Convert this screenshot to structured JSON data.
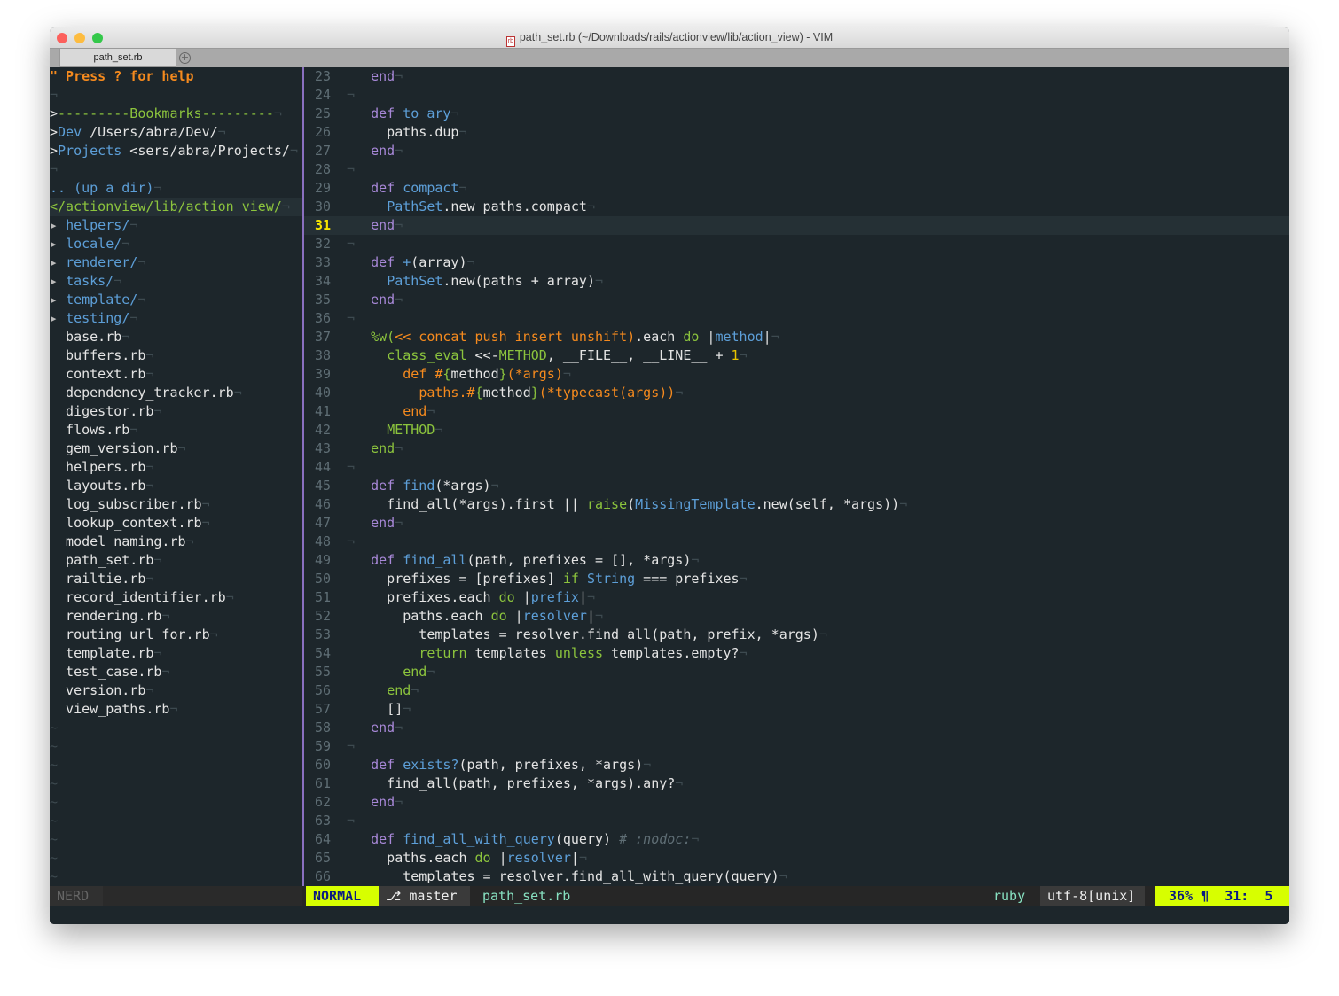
{
  "window": {
    "title": "path_set.rb (~/Downloads/rails/actionview/lib/action_view) - VIM",
    "file_icon": "ruby-file-icon",
    "tab": "path_set.rb",
    "new_tab": "+"
  },
  "colors": {
    "background": "#1d262b",
    "keyword": "#a888d8",
    "function": "#5d9fd8",
    "green": "#8cc43d",
    "orange": "#f58a1e",
    "mode_bg": "#d7ff00",
    "divider": "#8a6fbf"
  },
  "tree": {
    "rows": [
      [
        [
          "\" Press ? for help",
          "help"
        ]
      ],
      [],
      [
        [
          ">",
          "t"
        ],
        [
          "---------Bookmarks---------",
          "tl"
        ]
      ],
      [
        [
          ">",
          "t"
        ],
        [
          "Dev",
          "bmname"
        ],
        [
          " /Users/abra/Dev/",
          "t"
        ]
      ],
      [
        [
          ">",
          "t"
        ],
        [
          "Projects",
          "bmname"
        ],
        [
          " <sers/abra/Projects/",
          "t"
        ]
      ],
      [],
      [
        [
          ".. (up a dir)",
          "up"
        ]
      ],
      [
        [
          "</actionview/lib/action_view/",
          "cwd"
        ]
      ],
      [
        [
          "▸ ",
          "arrow"
        ],
        [
          "helpers/",
          "dir"
        ]
      ],
      [
        [
          "▸ ",
          "arrow"
        ],
        [
          "locale/",
          "dir"
        ]
      ],
      [
        [
          "▸ ",
          "arrow"
        ],
        [
          "renderer/",
          "dir"
        ]
      ],
      [
        [
          "▸ ",
          "arrow"
        ],
        [
          "tasks/",
          "dir"
        ]
      ],
      [
        [
          "▸ ",
          "arrow"
        ],
        [
          "template/",
          "dir"
        ]
      ],
      [
        [
          "▸ ",
          "arrow"
        ],
        [
          "testing/",
          "dir"
        ]
      ],
      [
        [
          "  base.rb",
          "t"
        ]
      ],
      [
        [
          "  buffers.rb",
          "t"
        ]
      ],
      [
        [
          "  context.rb",
          "t"
        ]
      ],
      [
        [
          "  dependency_tracker.rb",
          "t"
        ]
      ],
      [
        [
          "  digestor.rb",
          "t"
        ]
      ],
      [
        [
          "  flows.rb",
          "t"
        ]
      ],
      [
        [
          "  gem_version.rb",
          "t"
        ]
      ],
      [
        [
          "  helpers.rb",
          "t"
        ]
      ],
      [
        [
          "  layouts.rb",
          "t"
        ]
      ],
      [
        [
          "  log_subscriber.rb",
          "t"
        ]
      ],
      [
        [
          "  lookup_context.rb",
          "t"
        ]
      ],
      [
        [
          "  model_naming.rb",
          "t"
        ]
      ],
      [
        [
          "  path_set.rb",
          "t"
        ]
      ],
      [
        [
          "  railtie.rb",
          "t"
        ]
      ],
      [
        [
          "  record_identifier.rb",
          "t"
        ]
      ],
      [
        [
          "  rendering.rb",
          "t"
        ]
      ],
      [
        [
          "  routing_url_for.rb",
          "t"
        ]
      ],
      [
        [
          "  template.rb",
          "t"
        ]
      ],
      [
        [
          "  test_case.rb",
          "t"
        ]
      ],
      [
        [
          "  version.rb",
          "t"
        ]
      ],
      [
        [
          "  view_paths.rb",
          "t"
        ]
      ]
    ],
    "tilde": "~"
  },
  "editor": {
    "eol_marker": "¬",
    "cursor_line": 31,
    "lines": [
      {
        "n": "23",
        "t": [
          [
            "    ",
            ""
          ],
          [
            "end",
            "k"
          ]
        ]
      },
      {
        "n": "24",
        "t": []
      },
      {
        "n": "25",
        "t": [
          [
            "    ",
            ""
          ],
          [
            "def",
            "k"
          ],
          [
            " ",
            ""
          ],
          [
            "to_ary",
            "f"
          ]
        ]
      },
      {
        "n": "26",
        "t": [
          [
            "      paths.dup",
            "t"
          ]
        ]
      },
      {
        "n": "27",
        "t": [
          [
            "    ",
            ""
          ],
          [
            "end",
            "k"
          ]
        ]
      },
      {
        "n": "28",
        "t": []
      },
      {
        "n": "29",
        "t": [
          [
            "    ",
            ""
          ],
          [
            "def",
            "k"
          ],
          [
            " ",
            ""
          ],
          [
            "compact",
            "f"
          ]
        ]
      },
      {
        "n": "30",
        "t": [
          [
            "      ",
            ""
          ],
          [
            "PathSet",
            "f"
          ],
          [
            ".new paths.compact",
            "t"
          ]
        ]
      },
      {
        "n": "31",
        "t": [
          [
            "    ",
            ""
          ],
          [
            "end",
            "k"
          ]
        ]
      },
      {
        "n": "32",
        "t": []
      },
      {
        "n": "33",
        "t": [
          [
            "    ",
            ""
          ],
          [
            "def",
            "k"
          ],
          [
            " ",
            ""
          ],
          [
            "+",
            "f"
          ],
          [
            "(array)",
            "t"
          ]
        ]
      },
      {
        "n": "34",
        "t": [
          [
            "      ",
            ""
          ],
          [
            "PathSet",
            "f"
          ],
          [
            ".new(paths + array)",
            "t"
          ]
        ]
      },
      {
        "n": "35",
        "t": [
          [
            "    ",
            ""
          ],
          [
            "end",
            "k"
          ]
        ]
      },
      {
        "n": "36",
        "t": []
      },
      {
        "n": "37",
        "t": [
          [
            "    ",
            ""
          ],
          [
            "%w(",
            "g"
          ],
          [
            "<< concat push insert unshift)",
            "o"
          ],
          [
            ".each ",
            "t"
          ],
          [
            "do",
            "g"
          ],
          [
            " |",
            "t"
          ],
          [
            "method",
            "f"
          ],
          [
            "|",
            "t"
          ]
        ]
      },
      {
        "n": "38",
        "t": [
          [
            "      ",
            ""
          ],
          [
            "class_eval",
            "g"
          ],
          [
            " <<-",
            "t"
          ],
          [
            "METHOD",
            "g"
          ],
          [
            ", __FILE__, __LINE__ + ",
            "t"
          ],
          [
            "1",
            "n"
          ]
        ]
      },
      {
        "n": "39",
        "t": [
          [
            "        ",
            ""
          ],
          [
            "def #",
            "o"
          ],
          [
            "{",
            "g"
          ],
          [
            "method",
            "t"
          ],
          [
            "}",
            "g"
          ],
          [
            "(*args)",
            "o"
          ]
        ]
      },
      {
        "n": "40",
        "t": [
          [
            "          ",
            ""
          ],
          [
            "paths.#",
            "o"
          ],
          [
            "{",
            "g"
          ],
          [
            "method",
            "t"
          ],
          [
            "}",
            "g"
          ],
          [
            "(*typecast(args))",
            "o"
          ]
        ]
      },
      {
        "n": "41",
        "t": [
          [
            "        ",
            ""
          ],
          [
            "end",
            "o"
          ]
        ]
      },
      {
        "n": "42",
        "t": [
          [
            "      ",
            ""
          ],
          [
            "METHOD",
            "g"
          ]
        ]
      },
      {
        "n": "43",
        "t": [
          [
            "    ",
            ""
          ],
          [
            "end",
            "g"
          ]
        ]
      },
      {
        "n": "44",
        "t": []
      },
      {
        "n": "45",
        "t": [
          [
            "    ",
            ""
          ],
          [
            "def",
            "k"
          ],
          [
            " ",
            ""
          ],
          [
            "find",
            "f"
          ],
          [
            "(*args)",
            "t"
          ]
        ]
      },
      {
        "n": "46",
        "t": [
          [
            "      find_all(*args).first || ",
            "t"
          ],
          [
            "raise",
            "g"
          ],
          [
            "(",
            "t"
          ],
          [
            "MissingTemplate",
            "f"
          ],
          [
            ".new(self, *args))",
            "t"
          ]
        ]
      },
      {
        "n": "47",
        "t": [
          [
            "    ",
            ""
          ],
          [
            "end",
            "k"
          ]
        ]
      },
      {
        "n": "48",
        "t": []
      },
      {
        "n": "49",
        "t": [
          [
            "    ",
            ""
          ],
          [
            "def",
            "k"
          ],
          [
            " ",
            ""
          ],
          [
            "find_all",
            "f"
          ],
          [
            "(path, prefixes = [], *args)",
            "t"
          ]
        ]
      },
      {
        "n": "50",
        "t": [
          [
            "      prefixes = [prefixes] ",
            "t"
          ],
          [
            "if",
            "g"
          ],
          [
            " ",
            ""
          ],
          [
            "String",
            "f"
          ],
          [
            " === prefixes",
            "t"
          ]
        ]
      },
      {
        "n": "51",
        "t": [
          [
            "      prefixes.each ",
            "t"
          ],
          [
            "do",
            "g"
          ],
          [
            " |",
            "t"
          ],
          [
            "prefix",
            "f"
          ],
          [
            "|",
            "t"
          ]
        ]
      },
      {
        "n": "52",
        "t": [
          [
            "        paths.each ",
            "t"
          ],
          [
            "do",
            "g"
          ],
          [
            " |",
            "t"
          ],
          [
            "resolver",
            "f"
          ],
          [
            "|",
            "t"
          ]
        ]
      },
      {
        "n": "53",
        "t": [
          [
            "          templates = resolver.find_all(path, prefix, *args)",
            "t"
          ]
        ]
      },
      {
        "n": "54",
        "t": [
          [
            "          ",
            ""
          ],
          [
            "return",
            "g"
          ],
          [
            " templates ",
            "t"
          ],
          [
            "unless",
            "g"
          ],
          [
            " templates.empty?",
            "t"
          ]
        ]
      },
      {
        "n": "55",
        "t": [
          [
            "        ",
            ""
          ],
          [
            "end",
            "g"
          ]
        ]
      },
      {
        "n": "56",
        "t": [
          [
            "      ",
            ""
          ],
          [
            "end",
            "g"
          ]
        ]
      },
      {
        "n": "57",
        "t": [
          [
            "      []",
            "t"
          ]
        ]
      },
      {
        "n": "58",
        "t": [
          [
            "    ",
            ""
          ],
          [
            "end",
            "k"
          ]
        ]
      },
      {
        "n": "59",
        "t": []
      },
      {
        "n": "60",
        "t": [
          [
            "    ",
            ""
          ],
          [
            "def",
            "k"
          ],
          [
            " ",
            ""
          ],
          [
            "exists?",
            "f"
          ],
          [
            "(path, prefixes, *args)",
            "t"
          ]
        ]
      },
      {
        "n": "61",
        "t": [
          [
            "      find_all(path, prefixes, *args).any?",
            "t"
          ]
        ]
      },
      {
        "n": "62",
        "t": [
          [
            "    ",
            ""
          ],
          [
            "end",
            "k"
          ]
        ]
      },
      {
        "n": "63",
        "t": []
      },
      {
        "n": "64",
        "t": [
          [
            "    ",
            ""
          ],
          [
            "def",
            "k"
          ],
          [
            " ",
            ""
          ],
          [
            "find_all_with_query",
            "f"
          ],
          [
            "(query) ",
            "t"
          ],
          [
            "# :nodoc:",
            "c"
          ]
        ]
      },
      {
        "n": "65",
        "t": [
          [
            "      paths.each ",
            "t"
          ],
          [
            "do",
            "g"
          ],
          [
            " |",
            "t"
          ],
          [
            "resolver",
            "f"
          ],
          [
            "|",
            "t"
          ]
        ]
      },
      {
        "n": "66",
        "t": [
          [
            "        templates = resolver.find_all_with_query(query)",
            "t"
          ]
        ]
      }
    ]
  },
  "statusline": {
    "nerd": "NERD",
    "mode": "NORMAL",
    "branch_icon": "⎇",
    "branch": "master",
    "filename": "path_set.rb",
    "filetype": "ruby",
    "encoding": "utf-8[unix]",
    "percent": "36%",
    "line_icon": "¶",
    "position": "31:  5"
  }
}
